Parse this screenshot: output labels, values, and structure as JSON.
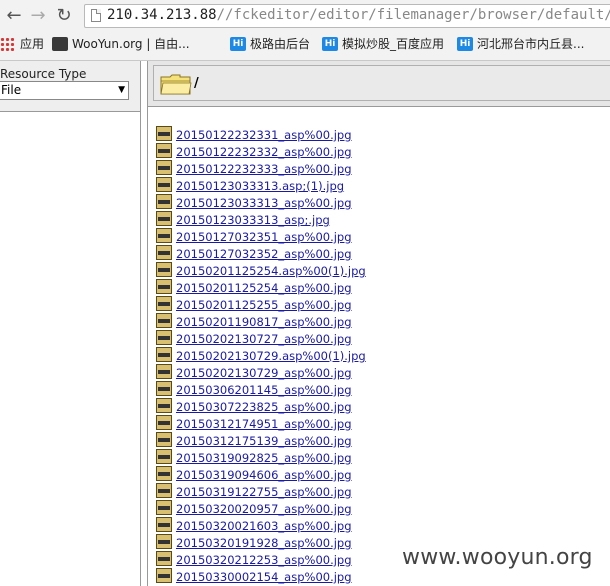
{
  "browser": {
    "url_host": "210.34.213.88",
    "url_path": "//fckeditor/editor/filemanager/browser/default/browser",
    "bookmarks": [
      {
        "label": "应用",
        "icon": "apps-grid-icon"
      },
      {
        "label": "WooYun.org | 自由...",
        "icon": "wooyun-icon"
      },
      {
        "label": "极路由后台",
        "icon": "hi-icon"
      },
      {
        "label": "模拟炒股_百度应用",
        "icon": "hi-icon"
      },
      {
        "label": "河北邢台市内丘县...",
        "icon": "hi-icon"
      }
    ]
  },
  "left_panel": {
    "resource_type_label": "Resource Type",
    "resource_type_value": "File"
  },
  "right_panel": {
    "current_folder": "/",
    "files": [
      "20150122232331_asp%00.jpg",
      "20150122232332_asp%00.jpg",
      "20150122232333_asp%00.jpg",
      "20150123033313.asp;(1).jpg",
      "20150123033313_asp%00.jpg",
      "20150123033313_asp;.jpg",
      "20150127032351_asp%00.jpg",
      "20150127032352_asp%00.jpg",
      "20150201125254.asp%00(1).jpg",
      "20150201125254_asp%00.jpg",
      "20150201125255_asp%00.jpg",
      "20150201190817_asp%00.jpg",
      "20150202130727_asp%00.jpg",
      "20150202130729.asp%00(1).jpg",
      "20150202130729_asp%00.jpg",
      "20150306201145_asp%00.jpg",
      "20150307223825_asp%00.jpg",
      "20150312174951_asp%00.jpg",
      "20150312175139_asp%00.jpg",
      "20150319092825_asp%00.jpg",
      "20150319094606_asp%00.jpg",
      "20150319122755_asp%00.jpg",
      "20150320020957_asp%00.jpg",
      "20150320021603_asp%00.jpg",
      "20150320191928_asp%00.jpg",
      "20150320212253_asp%00.jpg",
      "20150330002154_asp%00.jpg"
    ]
  },
  "watermark": "www.wooyun.org"
}
